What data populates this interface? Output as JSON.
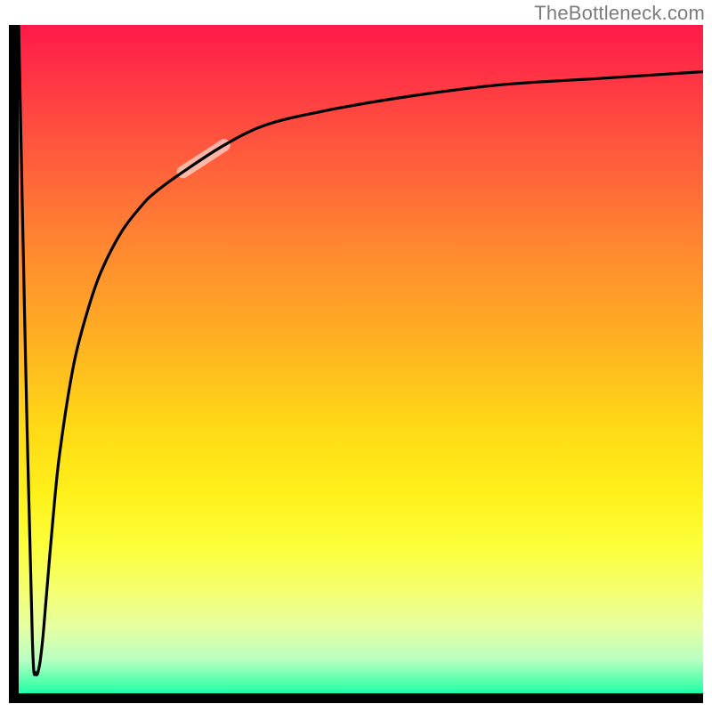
{
  "attribution": "TheBottleneck.com",
  "chart_data": {
    "type": "line",
    "title": "",
    "xlabel": "",
    "ylabel": "",
    "xlim": [
      0,
      100
    ],
    "ylim": [
      0,
      100
    ],
    "grid": false,
    "legend": false,
    "gradient_stops": [
      {
        "pos": 0,
        "color": "#ff1a49"
      },
      {
        "pos": 20,
        "color": "#ff5d3c"
      },
      {
        "pos": 48,
        "color": "#ffb321"
      },
      {
        "pos": 70,
        "color": "#fff01a"
      },
      {
        "pos": 90,
        "color": "#e6ffa0"
      },
      {
        "pos": 100,
        "color": "#1bffb2"
      }
    ],
    "highlight_segment": {
      "x_start": 24,
      "x_end": 30
    },
    "series": [
      {
        "name": "curve",
        "x": [
          0,
          1,
          2,
          2.5,
          3,
          3.5,
          4,
          5,
          6,
          8,
          10,
          12,
          15,
          18,
          20,
          24,
          30,
          36,
          44,
          55,
          70,
          85,
          100
        ],
        "values": [
          100,
          50,
          8,
          3,
          4,
          8,
          14,
          26,
          36,
          49,
          57,
          63,
          69,
          73,
          75,
          78,
          82,
          85,
          87,
          89,
          91,
          92,
          93
        ]
      }
    ]
  }
}
